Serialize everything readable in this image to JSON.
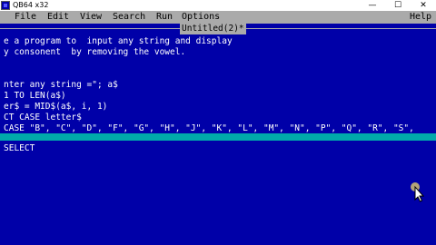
{
  "window": {
    "title": "QB64 x32",
    "minimize_icon": "minimize-icon",
    "maximize_icon": "maximize-icon",
    "close_icon": "close-icon",
    "minimize_glyph": "—",
    "maximize_glyph": "☐",
    "close_glyph": "✕"
  },
  "menu": {
    "file": "File",
    "edit": "Edit",
    "view": "View",
    "search": "Search",
    "run": "Run",
    "options": "Options",
    "help": "Help"
  },
  "editor": {
    "tab_label": "Untitled(2)*",
    "lines": [
      "e a program to  input any string and display",
      "y consonent  by removing the vowel.",
      "",
      "",
      "nter any string =\"; a$",
      "1 TO LEN(a$)",
      "er$ = MID$(a$, i, 1)",
      "CT CASE letter$",
      "CASE \"B\", \"C\", \"D\", \"F\", \"G\", \"H\", \"J\", \"K\", \"L\", \"M\", \"N\", \"P\", \"Q\", \"R\", \"S\","
    ],
    "status_text": "SELECT"
  },
  "colors": {
    "editor_bg": "#0000a8",
    "menu_bg": "#aaaaaa",
    "text": "#ffffff",
    "highlight_bar": "#00aaaa"
  }
}
